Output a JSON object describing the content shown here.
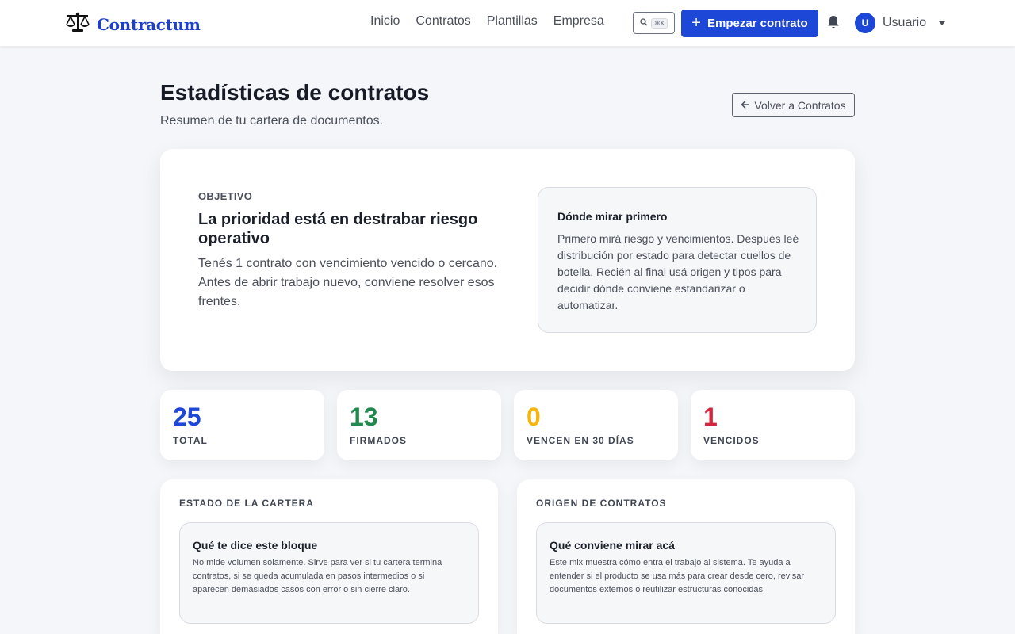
{
  "app": {
    "brand": "Contractum",
    "brand_icon": "balance-scale-icon",
    "accent_color": "#1d47d6"
  },
  "nav": {
    "items": [
      {
        "label": "Inicio"
      },
      {
        "label": "Contratos"
      },
      {
        "label": "Plantillas"
      },
      {
        "label": "Empresa"
      }
    ],
    "search_shortcut": "⌘K",
    "cta_label": "Empezar contrato",
    "user_initial": "U",
    "user_name": "Usuario"
  },
  "header": {
    "title": "Estadísticas de contratos",
    "subtitle": "Resumen de tu cartera de documentos.",
    "back_label": "Volver a Contratos"
  },
  "objective": {
    "eyebrow": "OBJETIVO",
    "title": "La prioridad está en destrabar riesgo operativo",
    "body": "Tenés 1 contrato con vencimiento vencido o cercano. Antes de abrir trabajo nuevo, conviene resolver esos frentes.",
    "tip_title": "Dónde mirar primero",
    "tip_body": "Primero mirá riesgo y vencimientos. Después leé distribución por estado para detectar cuellos de botella. Recién al final usá origen y tipos para decidir dónde conviene estandarizar o automatizar."
  },
  "stats": [
    {
      "value": "25",
      "label": "TOTAL",
      "color": "#1d47d6"
    },
    {
      "value": "13",
      "label": "FIRMADOS",
      "color": "#1f8a4c"
    },
    {
      "value": "0",
      "label": "VENCEN EN 30 DÍAS",
      "color": "#f5b50a"
    },
    {
      "value": "1",
      "label": "VENCIDOS",
      "color": "#d3273e"
    }
  ],
  "panels": [
    {
      "heading": "ESTADO DE LA CARTERA",
      "tip_title": "Qué te dice este bloque",
      "tip_body": "No mide volumen solamente. Sirve para ver si tu cartera termina contratos, si se queda acumulada en pasos intermedios o si aparecen demasiados casos con error o sin cierre claro."
    },
    {
      "heading": "ORIGEN DE CONTRATOS",
      "tip_title": "Qué conviene mirar acá",
      "tip_body": "Este mix muestra cómo entra el trabajo al sistema. Te ayuda a entender si el producto se usa más para crear desde cero, revisar documentos externos o reutilizar estructuras conocidas."
    }
  ]
}
